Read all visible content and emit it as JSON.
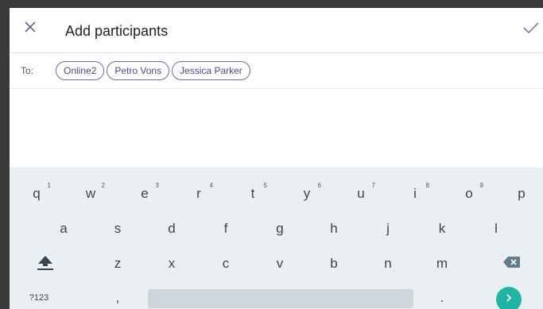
{
  "header": {
    "title": "Add participants",
    "close_icon": "close-icon",
    "confirm_icon": "check-icon"
  },
  "recipients": {
    "to_label": "To:",
    "chips": [
      "Online2",
      "Petro Vons",
      "Jessica Parker"
    ]
  },
  "keyboard": {
    "row1": [
      {
        "key": "q",
        "hint": "1"
      },
      {
        "key": "w",
        "hint": "2"
      },
      {
        "key": "e",
        "hint": "3"
      },
      {
        "key": "r",
        "hint": "4"
      },
      {
        "key": "t",
        "hint": "5"
      },
      {
        "key": "y",
        "hint": "6"
      },
      {
        "key": "u",
        "hint": "7"
      },
      {
        "key": "i",
        "hint": "8"
      },
      {
        "key": "o",
        "hint": "9"
      },
      {
        "key": "p",
        "hint": ""
      }
    ],
    "row2": [
      "a",
      "s",
      "d",
      "f",
      "g",
      "h",
      "j",
      "k",
      "l"
    ],
    "row3": [
      "z",
      "x",
      "c",
      "v",
      "b",
      "n",
      "m"
    ],
    "symbols_label": "?123",
    "comma": ",",
    "period": ".",
    "shift_icon": "shift-icon",
    "backspace_icon": "backspace-icon",
    "enter_icon": "chevron-right-icon"
  },
  "colors": {
    "chip_border": "#6f6aa8",
    "accent": "#21b3a4",
    "keyboard_bg": "#eceff1"
  }
}
